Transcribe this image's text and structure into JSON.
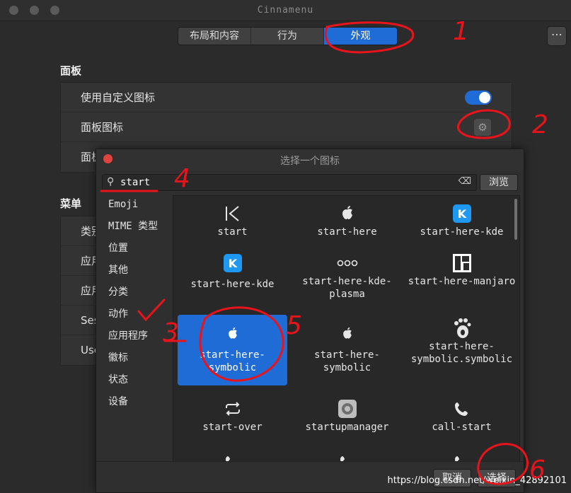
{
  "window": {
    "title": "Cinnamenu"
  },
  "tabs": [
    "布局和内容",
    "行为",
    "外观"
  ],
  "more_label": "⋯",
  "panel_section": {
    "title": "面板",
    "rows": [
      {
        "label": "使用自定义图标"
      },
      {
        "label": "面板图标"
      },
      {
        "label": "面板"
      }
    ]
  },
  "menu_section": {
    "title": "菜单",
    "rows": [
      {
        "label": "类别"
      },
      {
        "label": "应用"
      },
      {
        "label": "应用"
      },
      {
        "label": "Ses"
      },
      {
        "label": "Use"
      }
    ]
  },
  "dialog": {
    "title": "选择一个图标",
    "search_value": "start",
    "browse_label": "浏览",
    "categories": [
      "Emoji",
      "MIME 类型",
      "位置",
      "其他",
      "分类",
      "动作",
      "应用程序",
      "徽标",
      "状态",
      "设备"
    ],
    "icons": [
      {
        "name": "start",
        "icon": "skip-start-icon"
      },
      {
        "name": "start-here",
        "icon": "apple-icon"
      },
      {
        "name": "start-here-kde",
        "icon": "kde-icon"
      },
      {
        "name": "start-here-kde",
        "icon": "kde-icon"
      },
      {
        "name": "start-here-kde-plasma",
        "icon": "dots-icon"
      },
      {
        "name": "start-here-manjaro",
        "icon": "manjaro-icon"
      },
      {
        "name": "start-here-symbolic",
        "icon": "apple-icon"
      },
      {
        "name": "start-here-symbolic",
        "icon": "apple-icon"
      },
      {
        "name": "start-here-symbolic.symbolic",
        "icon": "gnome-foot-icon"
      },
      {
        "name": "start-over",
        "icon": "repeat-icon"
      },
      {
        "name": "startupmanager",
        "icon": "startup-icon"
      },
      {
        "name": "call-start",
        "icon": "phone-icon"
      }
    ],
    "cancel_label": "取消",
    "select_label": "选择"
  },
  "annotations": [
    "1",
    "2",
    "3",
    "4",
    "5",
    "6"
  ],
  "watermark": "https://blog.csdn.net/weixin_42892101",
  "colors": {
    "accent": "#1f6cd6",
    "annotation": "#e8141c"
  }
}
